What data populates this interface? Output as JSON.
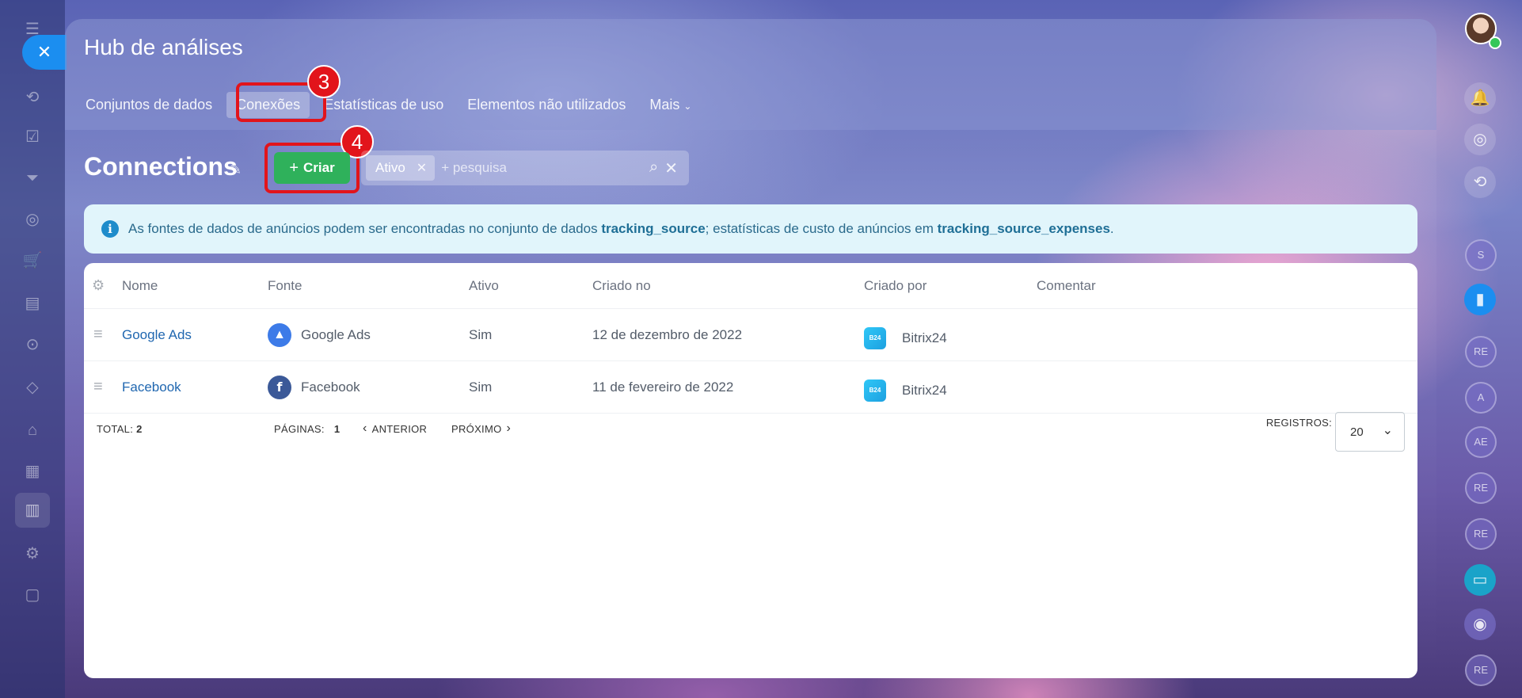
{
  "app_title": "Hub de análises",
  "tabs": [
    {
      "label": "Conjuntos de dados",
      "active": false
    },
    {
      "label": "Conexões",
      "active": true
    },
    {
      "label": "Estatísticas de uso",
      "active": false
    },
    {
      "label": "Elementos não utilizados",
      "active": false
    },
    {
      "label": "Mais",
      "active": false
    }
  ],
  "annotations": {
    "step3": "3",
    "step4": "4"
  },
  "page_title": "Connections",
  "create_button": {
    "label": "Criar"
  },
  "filter": {
    "chip": "Ativo",
    "placeholder": "+ pesquisa"
  },
  "info": {
    "part1": "As fontes de dados de anúncios podem ser encontradas no conjunto de dados",
    "dataset1": "tracking_source",
    "part2": "; estatísticas de custo de anúncios em",
    "dataset2": "tracking_source_expenses",
    "part3": "."
  },
  "table": {
    "headers": {
      "name": "Nome",
      "source": "Fonte",
      "active": "Ativo",
      "created_on": "Criado no",
      "created_by": "Criado por",
      "comment": "Comentar"
    },
    "rows": [
      {
        "name": "Google Ads",
        "source": "Google Ads",
        "source_icon": "google-ads-icon",
        "active": "Sim",
        "created_on": "12 de dezembro de 2022",
        "created_by": "Bitrix24",
        "comment": ""
      },
      {
        "name": "Facebook",
        "source": "Facebook",
        "source_icon": "facebook-icon",
        "active": "Sim",
        "created_on": "11 de fevereiro de 2022",
        "created_by": "Bitrix24",
        "comment": ""
      }
    ]
  },
  "footer": {
    "total_label": "TOTAL:",
    "total_value": "2",
    "pages_label": "PÁGINAS:",
    "pages_value": "1",
    "prev_label": "ANTERIOR",
    "next_label": "PRÓXIMO",
    "records_label": "REGISTROS:",
    "records_value": "20"
  },
  "right_bar": {
    "avatars": [
      "S",
      "RE",
      "A",
      "AE",
      "RE",
      "RE",
      "RE"
    ]
  },
  "colors": {
    "create": "#2fb15b",
    "highlight": "#e2141b",
    "info_bg": "#e1f5fb",
    "link": "#2067b0"
  }
}
